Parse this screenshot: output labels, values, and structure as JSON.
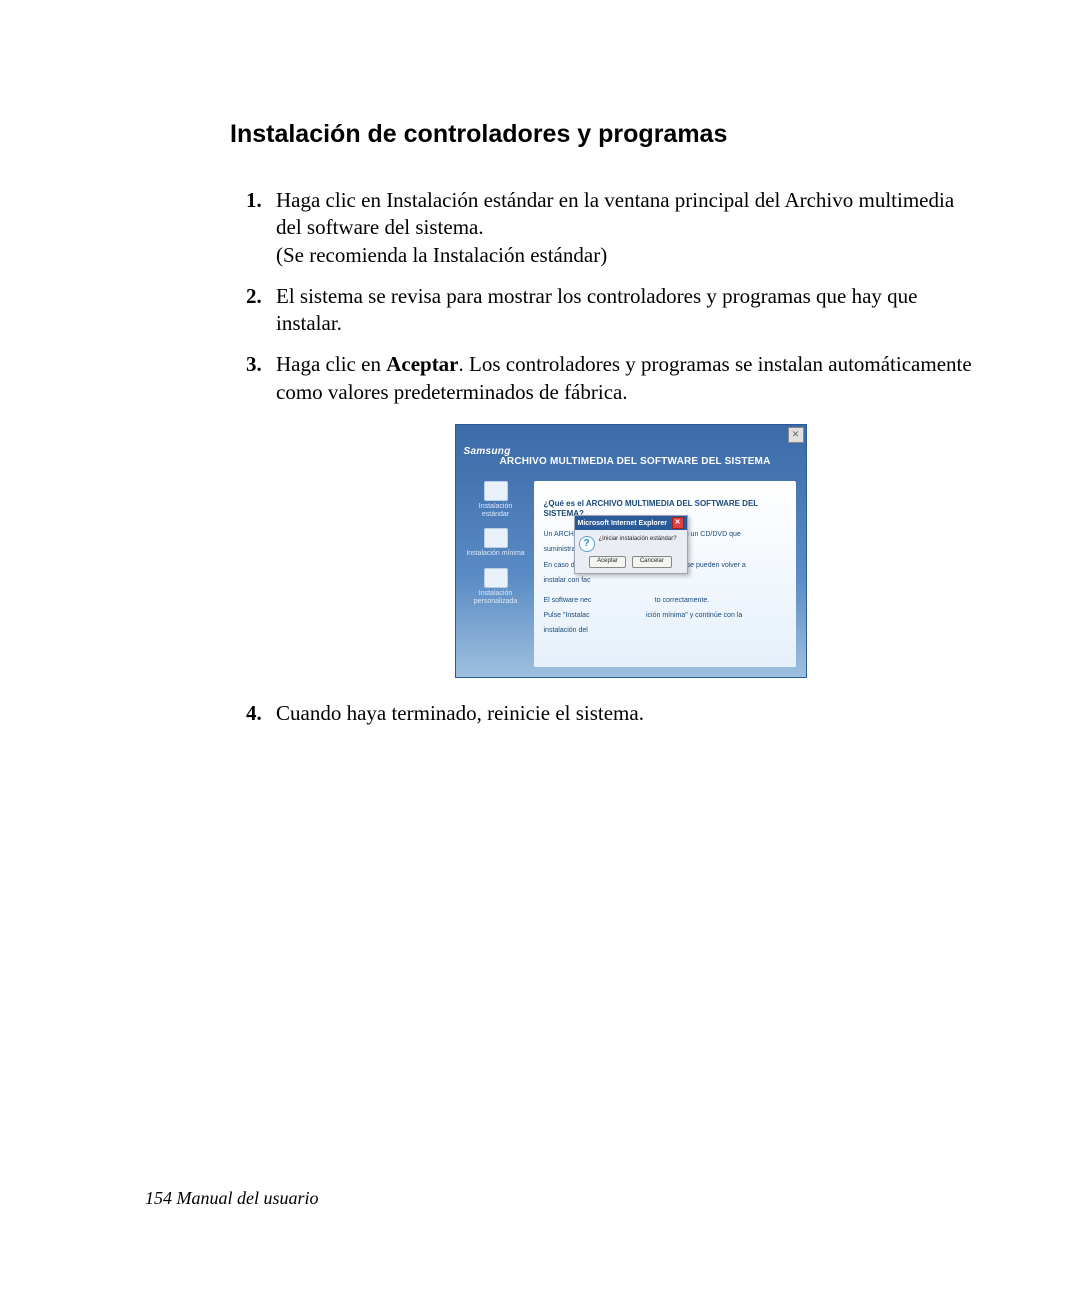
{
  "section_title": "Instalación de controladores y programas",
  "steps": {
    "s1_a": "Haga clic en Instalación estándar en la ventana principal del Archivo multimedia del software del sistema.",
    "s1_b": "(Se recomienda la Instalación estándar)",
    "s2": "El sistema se revisa para mostrar los controladores y programas que hay que instalar.",
    "s3_a": "Haga clic en ",
    "s3_bold": "Aceptar",
    "s3_b": ". Los controladores y programas se instalan automáticamente como valores predeterminados de fábrica.",
    "s4": "Cuando haya terminado, reinicie el sistema."
  },
  "screenshot": {
    "close_glyph": "✕",
    "brand": "Samsung",
    "headline": "ARCHIVO MULTIMEDIA DEL SOFTWARE DEL SISTEMA",
    "sidebar": {
      "item1": "Instalación estándar",
      "item2": "Instalación mínima",
      "item3": "Instalación personalizada"
    },
    "content": {
      "question": "¿Qué es el ARCHIVO MULTIMEDIA DEL SOFTWARE DEL SISTEMA?",
      "para1_left": "Un ARCHIVO M",
      "para1_right": "EMA en un CD/DVD que",
      "para2_left": "suministra Sar",
      "para3_left": "En caso de bro",
      "para3_right": "r software se pueden volver a",
      "para4_left": "instalar con fac",
      "para5_left": "El software nec",
      "para5_right": "to correctamente.",
      "para6_left": "Pulse \"Instalac",
      "para6_right": "ición mínima\" y continúe con la",
      "para7_left": "instalación del"
    },
    "dialog": {
      "title": "Microsoft Internet Explorer",
      "close": "✕",
      "qmark": "?",
      "message": "¿Iniciar instalación estándar?",
      "accept": "Aceptar",
      "cancel": "Cancelar"
    }
  },
  "footer": "154  Manual del usuario"
}
